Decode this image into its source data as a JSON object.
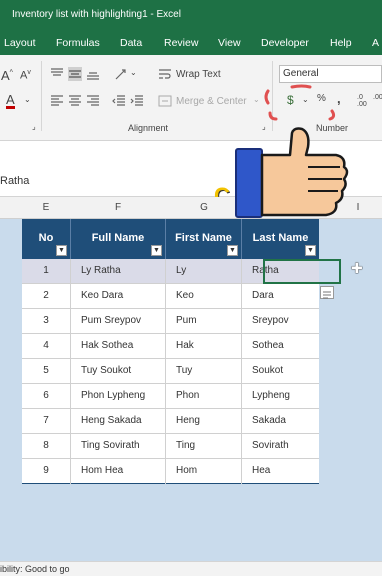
{
  "window": {
    "title": "Inventory list with highlighting1  -  Excel"
  },
  "ribbon_tabs": [
    "Layout",
    "Formulas",
    "Data",
    "Review",
    "View",
    "Developer",
    "Help",
    "A"
  ],
  "ribbon": {
    "wrap_text": "Wrap Text",
    "merge_center": "Merge & Center",
    "number_format": "General",
    "group_alignment": "Alignment",
    "group_number": "Number",
    "font_grow": "A",
    "font_shrink": "A",
    "font_color": "A"
  },
  "formula_bar": {
    "value": "Ratha"
  },
  "column_headers": [
    "E",
    "F",
    "G",
    "I"
  ],
  "table": {
    "headers": [
      "No",
      "Full Name",
      "First Name",
      "Last Name"
    ],
    "rows": [
      [
        "1",
        "Ly Ratha",
        "Ly",
        "Ratha"
      ],
      [
        "2",
        "Keo Dara",
        "Keo",
        "Dara"
      ],
      [
        "3",
        "Pum Sreypov",
        "Pum",
        "Sreypov"
      ],
      [
        "4",
        "Hak Sothea",
        "Hak",
        "Sothea"
      ],
      [
        "5",
        "Tuy Soukot",
        "Tuy",
        "Soukot"
      ],
      [
        "6",
        "Phon Lypheng",
        "Phon",
        "Lypheng"
      ],
      [
        "7",
        "Heng Sakada",
        "Heng",
        "Sakada"
      ],
      [
        "8",
        "Ting Sovirath",
        "Ting",
        "Sovirath"
      ],
      [
        "9",
        "Hom Hea",
        "Hom",
        "Hea"
      ]
    ]
  },
  "status": {
    "accessibility": "ibility: Good to go"
  },
  "overlay": {
    "partial_text": "C"
  },
  "colors": {
    "header_fill": "#1f4e79",
    "excel_green": "#1e7145",
    "selected_row": "#dadbe8"
  }
}
